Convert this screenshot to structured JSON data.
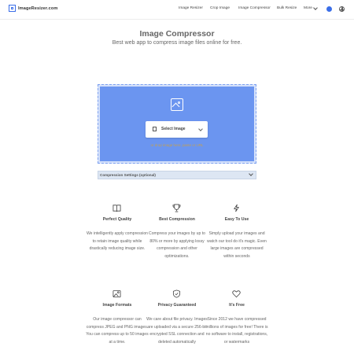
{
  "header": {
    "logo_text": "ImageResizer.com",
    "nav": [
      "Image Resizer",
      "Crop Image",
      "Image Compressor",
      "Bulk Resize"
    ],
    "more_label": "More",
    "icons": {
      "theme": "sun-icon",
      "language": "globe-icon"
    },
    "accent_color": "#3b6ee8"
  },
  "hero": {
    "title": "Image Compressor",
    "subtitle": "Best web app to compress image files online for free."
  },
  "upload": {
    "select_label": "Select Image",
    "hint": "or drop image here, paste or URL",
    "drop_color": "#6b95f0"
  },
  "settings": {
    "label": "Compression Settings (optional)"
  },
  "features": [
    {
      "icon": "book-icon",
      "title": "Perfect Quality",
      "desc": "We intelligently apply compression to retain image quality while drastically reducing image size."
    },
    {
      "icon": "trophy-icon",
      "title": "Best Compression",
      "desc": "Compress your images by up to 80% or more by applying lossy compression and other optimizations."
    },
    {
      "icon": "lightning-icon",
      "title": "Easy To Use",
      "desc": "Simply upload your images and watch our tool do it's magic. Even large images are compressed within seconds"
    },
    {
      "icon": "image-icon",
      "title": "Image Formats",
      "desc": "Our image compressor can compress JPEG and PNG images. You can compress up to 50 images at a time."
    },
    {
      "icon": "shield-icon",
      "title": "Privacy Guaranteed",
      "desc": "We care about file privacy. Images are uploaded via a secure 256-bit encrypted SSL connection and deleted automatically"
    },
    {
      "icon": "heart-icon",
      "title": "It's Free",
      "desc": "Since 2012 we have compressed millions of images for free! There is no software to install, registrations, or watermarks"
    }
  ]
}
